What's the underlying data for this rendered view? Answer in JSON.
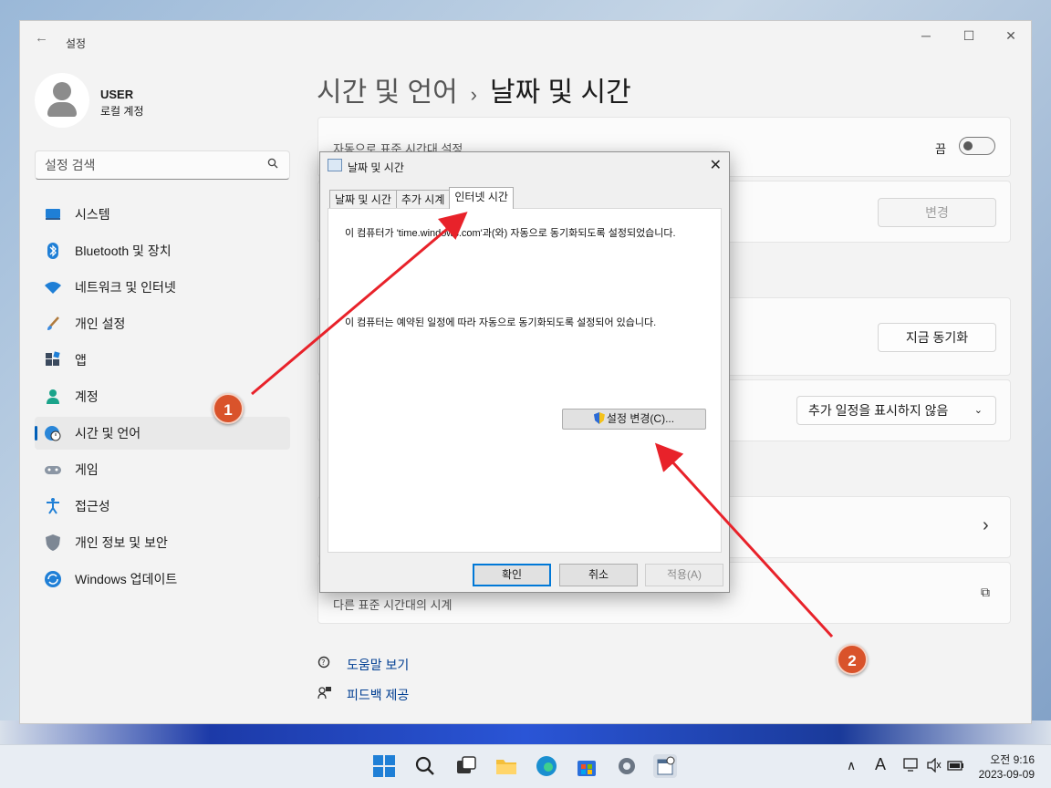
{
  "window": {
    "app_title": "설정",
    "back_symbol": "←",
    "minimize": "─",
    "maximize": "☐",
    "close": "✕"
  },
  "user": {
    "name": "USER",
    "account_type": "로컬 계정"
  },
  "search": {
    "placeholder": "설정 검색",
    "icon": "search-icon"
  },
  "sidebar": {
    "items": [
      {
        "label": "시스템",
        "icon": "monitor-icon"
      },
      {
        "label": "Bluetooth 및 장치",
        "icon": "bluetooth-icon"
      },
      {
        "label": "네트워크 및 인터넷",
        "icon": "wifi-icon"
      },
      {
        "label": "개인 설정",
        "icon": "brush-icon"
      },
      {
        "label": "앱",
        "icon": "apps-icon"
      },
      {
        "label": "계정",
        "icon": "person-icon"
      },
      {
        "label": "시간 및 언어",
        "icon": "clock-globe-icon",
        "active": true
      },
      {
        "label": "게임",
        "icon": "gamepad-icon"
      },
      {
        "label": "접근성",
        "icon": "accessibility-icon"
      },
      {
        "label": "개인 정보 및 보안",
        "icon": "shield-icon"
      },
      {
        "label": "Windows 업데이트",
        "icon": "update-icon"
      }
    ]
  },
  "header": {
    "crumb": "시간 및 언어",
    "separator": "›",
    "title": "날짜 및 시간"
  },
  "settings": {
    "auto_timezone_label": "자동으로 표준 시간대 설정",
    "auto_timezone_state": "끔",
    "change_button": "변경",
    "sync_now_button": "지금 동기화",
    "calendar_dropdown": "추가 일정을 표시하지 않음",
    "chevron_right": "›",
    "other_clocks_label": "다른 표준 시간대의 시계",
    "external_link": "⧉"
  },
  "footer": {
    "help": "도움말 보기",
    "feedback": "피드백 제공"
  },
  "dialog": {
    "title": "날짜 및 시간",
    "close": "✕",
    "tabs": [
      "날짜 및 시간",
      "추가 시계",
      "인터넷 시간"
    ],
    "active_tab": 2,
    "text1": "이 컴퓨터가 'time.windows.com'과(와) 자동으로 동기화되도록 설정되었습니다.",
    "text2": "이 컴퓨터는 예약된 일정에 따라 자동으로 동기화되도록 설정되어 있습니다.",
    "change_settings_button": "설정 변경(C)...",
    "ok_button": "확인",
    "cancel_button": "취소",
    "apply_button": "적용(A)"
  },
  "annotations": {
    "callout1": "1",
    "callout2": "2",
    "arrow_color": "#e8222a",
    "callout_color": "#d9532b"
  },
  "taskbar": {
    "tray_up": "∧",
    "ime": "A",
    "time": "오전 9:16",
    "date": "2023-09-09"
  },
  "colors": {
    "accent": "#005fb8",
    "window_bg": "#f3f3f3"
  }
}
